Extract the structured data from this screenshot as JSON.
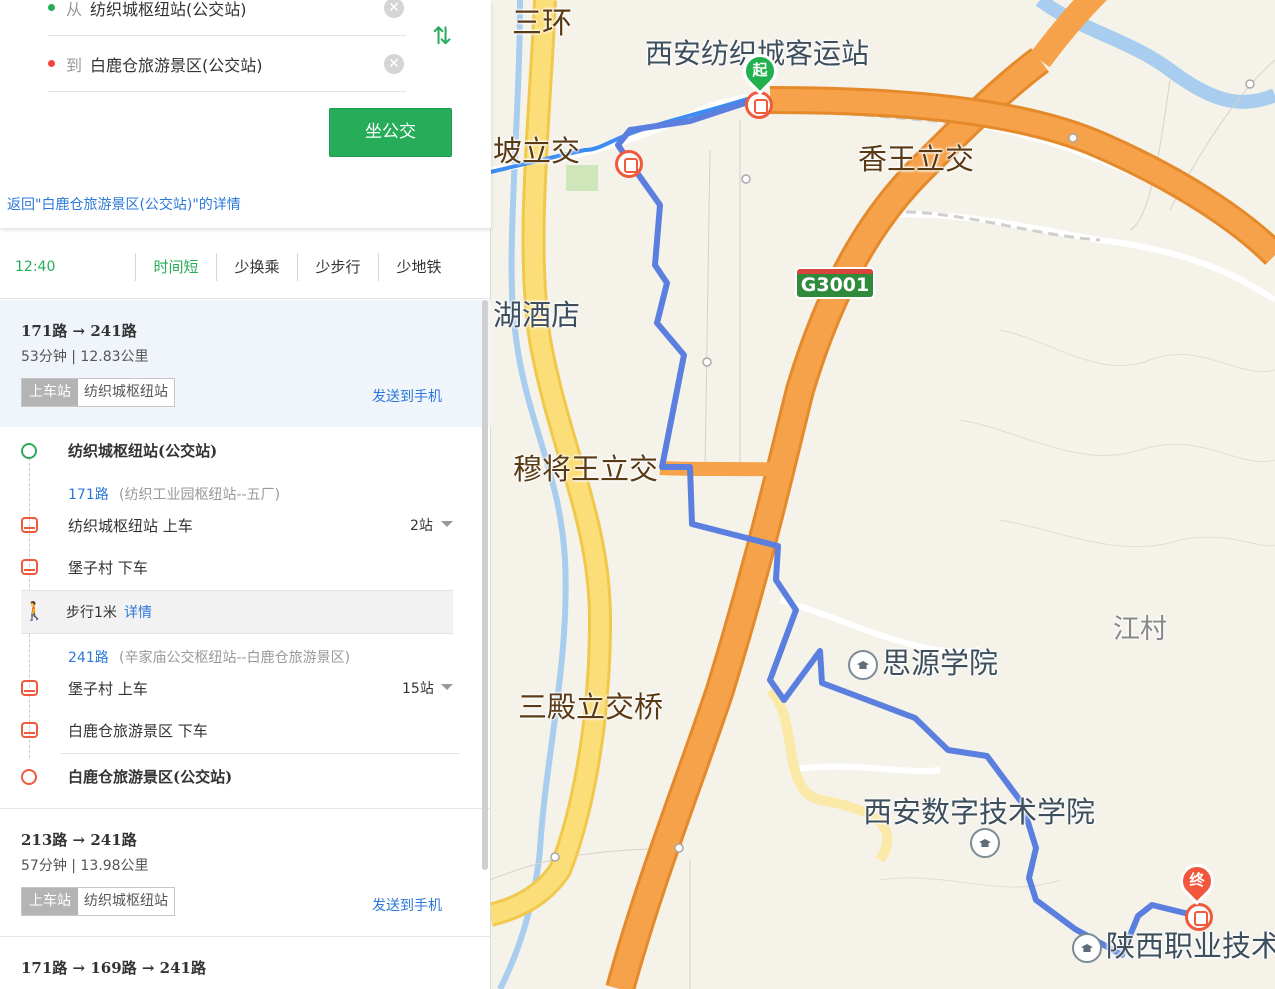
{
  "search": {
    "from_prefix": "从",
    "from_value": "纺织城枢纽站(公交站)",
    "to_prefix": "到",
    "to_value": "白鹿仓旅游景区(公交站)",
    "bus_button": "坐公交",
    "back_link": "返回\"白鹿仓旅游景区(公交站)\"的详情"
  },
  "filters": {
    "time": "12:40",
    "options": [
      "时间短",
      "少换乘",
      "少步行",
      "少地铁"
    ],
    "active": "时间短"
  },
  "plans": [
    {
      "lines": "171路 → 241路",
      "meta": "53分钟 | 12.83公里",
      "board_label": "上车站",
      "board_station": "纺织城枢纽站",
      "send": "发送到手机"
    },
    {
      "lines": "213路 → 241路",
      "meta": "57分钟 | 13.98公里",
      "board_label": "上车站",
      "board_station": "纺织城枢纽站",
      "send": "发送到手机"
    },
    {
      "lines": "171路 → 169路 → 241路",
      "meta": ""
    }
  ],
  "steps": {
    "origin": "纺织城枢纽站(公交站)",
    "line1": {
      "name": "171路",
      "range": "(纺织工业园枢纽站--五厂)"
    },
    "board1": {
      "name": "纺织城枢纽站 上车",
      "stops": "2站"
    },
    "alight1": "堡子村 下车",
    "walk": {
      "text": "步行1米",
      "detail": "详情"
    },
    "line2": {
      "name": "241路",
      "range": "(辛家庙公交枢纽站--白鹿仓旅游景区)"
    },
    "board2": {
      "name": "堡子村 上车",
      "stops": "15站"
    },
    "alight2": "白鹿仓旅游景区 下车",
    "destination": "白鹿仓旅游景区(公交站)"
  },
  "map": {
    "start_pin": "起",
    "end_pin": "终",
    "labels": {
      "ring": "三环",
      "origin_station": "西安纺织城客运站",
      "po_interchange": "坡立交",
      "xiangwang": "香王立交",
      "hotel": "湖酒店",
      "mujiangwang": "穆将王立交",
      "jiangcun": "江村",
      "siyuan": "思源学院",
      "sandian": "三殿立交桥",
      "digital_institute": "西安数字技术学院",
      "vocational": "陕西职业技术",
      "highway": "G3001"
    },
    "colors": {
      "route": "#5b7fde",
      "highway": "#f6a24b",
      "ring_road": "#fbde78",
      "accent_green": "#27ad59",
      "link_blue": "#2b78d8"
    }
  }
}
